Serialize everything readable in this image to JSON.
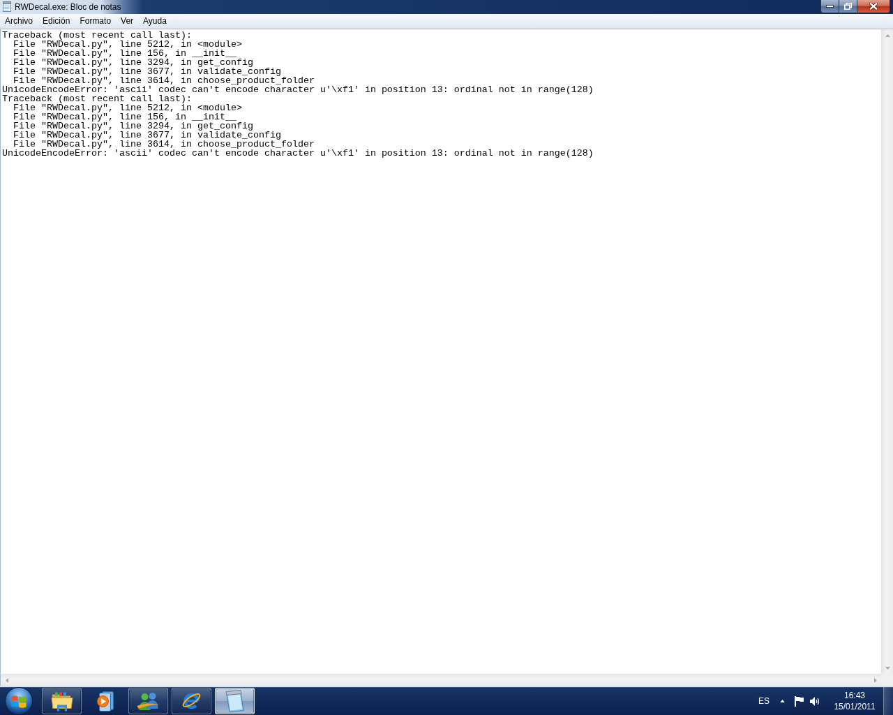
{
  "window": {
    "title": "RWDecal.exe: Bloc de notas"
  },
  "menu_bar": {
    "items": [
      "Archivo",
      "Edición",
      "Formato",
      "Ver",
      "Ayuda"
    ]
  },
  "document": {
    "lines": [
      "Traceback (most recent call last):",
      "  File \"RWDecal.py\", line 5212, in <module>",
      "  File \"RWDecal.py\", line 156, in __init__",
      "  File \"RWDecal.py\", line 3294, in get_config",
      "  File \"RWDecal.py\", line 3677, in validate_config",
      "  File \"RWDecal.py\", line 3614, in choose_product_folder",
      "UnicodeEncodeError: 'ascii' codec can't encode character u'\\xf1' in position 13: ordinal not in range(128)",
      "Traceback (most recent call last):",
      "  File \"RWDecal.py\", line 5212, in <module>",
      "  File \"RWDecal.py\", line 156, in __init__",
      "  File \"RWDecal.py\", line 3294, in get_config",
      "  File \"RWDecal.py\", line 3677, in validate_config",
      "  File \"RWDecal.py\", line 3614, in choose_product_folder",
      "UnicodeEncodeError: 'ascii' codec can't encode character u'\\xf1' in position 13: ordinal not in range(128)"
    ]
  },
  "taskbar": {
    "buttons": [
      {
        "kind": "files",
        "running": true,
        "selected": false
      },
      {
        "kind": "media",
        "running": false,
        "selected": false
      },
      {
        "kind": "chat",
        "running": true,
        "selected": false
      },
      {
        "kind": "browser",
        "running": true,
        "selected": false
      },
      {
        "kind": "editor",
        "running": true,
        "selected": true
      }
    ],
    "tray": {
      "language": "ES",
      "clock": {
        "time": "16:43",
        "date": "15/01/2011"
      }
    }
  }
}
